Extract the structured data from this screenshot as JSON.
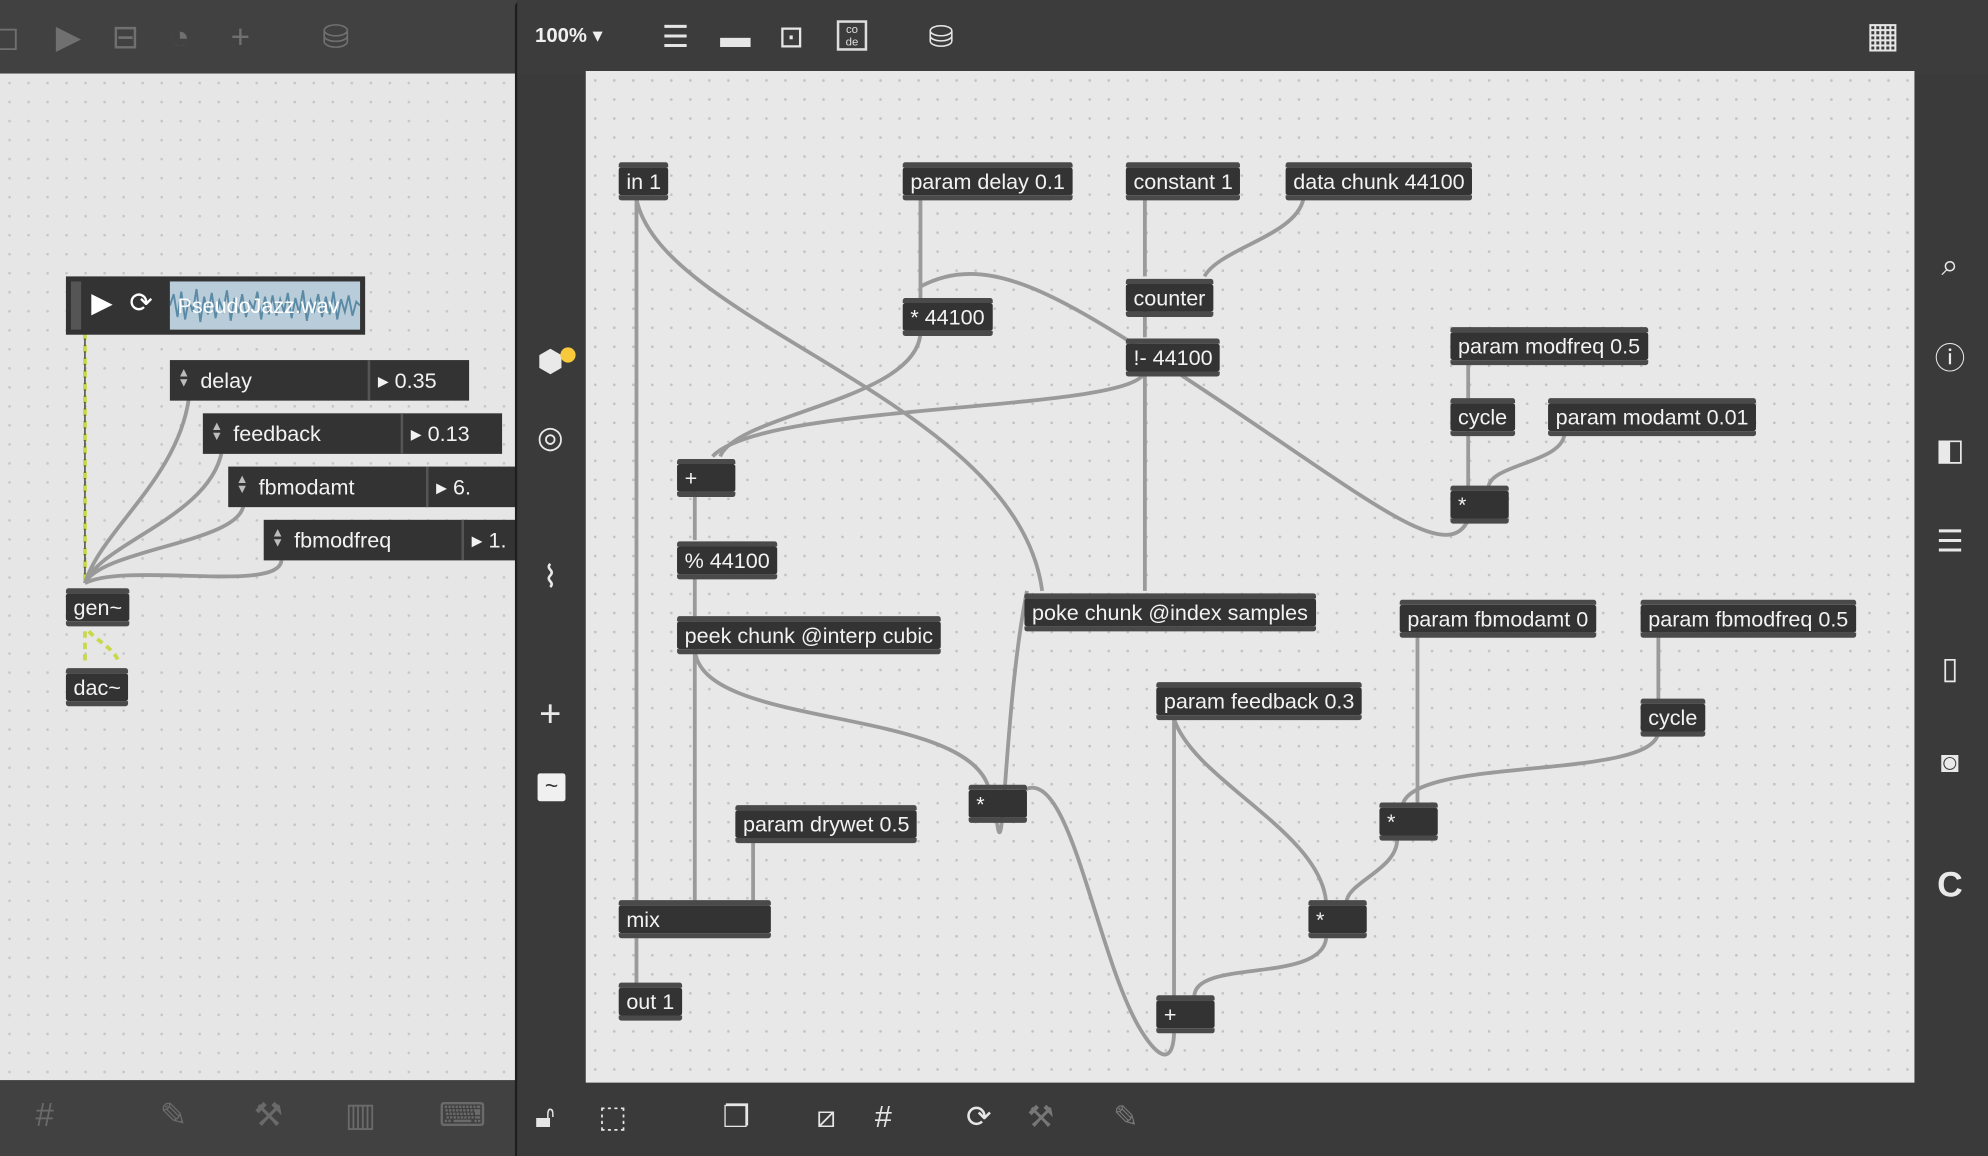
{
  "left_patcher": {
    "objects": {
      "gen": "gen~",
      "dac": "dac~"
    },
    "player": {
      "filename": "PseudoJazz.wav"
    },
    "params": [
      {
        "name": "delay",
        "value": "0.35"
      },
      {
        "name": "feedback",
        "value": "0.13"
      },
      {
        "name": "fbmodamt",
        "value": "6."
      },
      {
        "name": "fbmodfreq",
        "value": "1."
      }
    ]
  },
  "gen_patcher": {
    "zoom": "100%",
    "objects": {
      "in1": "in 1",
      "param_delay": "param delay 0.1",
      "constant": "constant 1",
      "data_chunk": "data chunk 44100",
      "mul_44100": "* 44100",
      "counter": "counter",
      "rsub_44100": "!- 44100",
      "param_modfreq": "param modfreq 0.5",
      "cycle1": "cycle",
      "param_modamt": "param modamt 0.01",
      "mul_mod": "*",
      "plus1": "+",
      "mod_44100": "% 44100",
      "peek": "peek chunk @interp cubic",
      "poke": "poke chunk @index samples",
      "param_fbmodamt": "param fbmodamt 0",
      "param_fbmodfreq": "param fbmodfreq 0.5",
      "param_feedback": "param feedback 0.3",
      "cycle2": "cycle",
      "mul_fb": "*",
      "param_drywet": "param drywet 0.5",
      "mul_fbmod": "*",
      "mul_fbtot": "*",
      "mix": "mix",
      "out1": "out 1",
      "plus2": "+"
    }
  },
  "icons": {
    "accent": "#f7c93b",
    "wire_audio": "#9a9a9a",
    "wire_signal_left": "#c8d84a"
  }
}
